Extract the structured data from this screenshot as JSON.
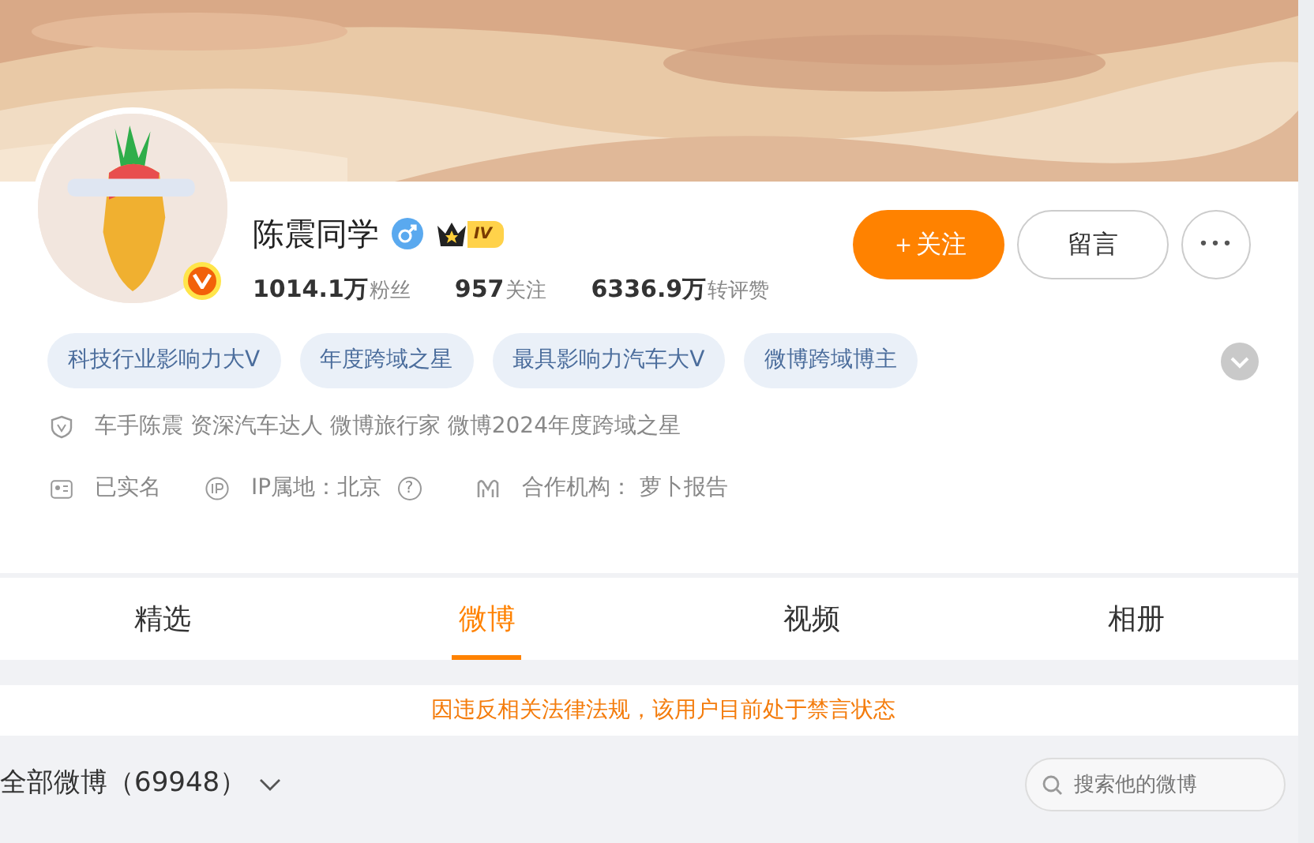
{
  "profile": {
    "name": "陈震同学",
    "level_badge": "IV",
    "stats": [
      {
        "value": "1014.1万",
        "label": "粉丝"
      },
      {
        "value": "957",
        "label": "关注"
      },
      {
        "value": "6336.9万",
        "label": "转评赞"
      }
    ],
    "buttons": [
      {
        "kind": "primary",
        "label": "＋关注"
      },
      {
        "kind": "outline",
        "label": "留言"
      },
      {
        "kind": "more",
        "label": "•••"
      }
    ],
    "tags": [
      "科技行业影响力大V",
      "年度跨域之星",
      "最具影响力汽车大V",
      "微博跨域博主"
    ],
    "verification": "车手陈震 资深汽车达人 微博旅行家 微博2024年度跨域之星",
    "info": [
      {
        "kind": "id",
        "text": "已实名"
      },
      {
        "kind": "ip",
        "text": "IP属地：北京",
        "help": "?"
      },
      {
        "kind": "org",
        "text": "合作机构：  萝卜报告"
      }
    ]
  },
  "tabs": [
    {
      "label": "精选",
      "selected": false
    },
    {
      "label": "微博",
      "selected": true
    },
    {
      "label": "视频",
      "selected": false
    },
    {
      "label": "相册",
      "selected": false
    }
  ],
  "notice": "因违反相关法律法规，该用户目前处于禁言状态",
  "feed_filter": {
    "label": "全部微博（69948）",
    "search_placeholder": "搜索他的微博"
  }
}
